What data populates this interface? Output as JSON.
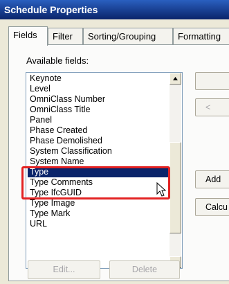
{
  "window": {
    "title": "Schedule Properties"
  },
  "tabs": [
    {
      "label": "Fields",
      "active": true
    },
    {
      "label": "Filter",
      "active": false
    },
    {
      "label": "Sorting/Grouping",
      "active": false
    },
    {
      "label": "Formatting",
      "active": false
    }
  ],
  "fields": {
    "label": "Available fields:",
    "items": [
      {
        "label": "Keynote"
      },
      {
        "label": "Level"
      },
      {
        "label": "OmniClass Number"
      },
      {
        "label": "OmniClass Title"
      },
      {
        "label": "Panel"
      },
      {
        "label": "Phase Created"
      },
      {
        "label": "Phase Demolished"
      },
      {
        "label": "System Classification"
      },
      {
        "label": "System Name"
      },
      {
        "label": "Type",
        "selected": true
      },
      {
        "label": "Type Comments"
      },
      {
        "label": "Type IfcGUID"
      },
      {
        "label": "Type Image"
      },
      {
        "label": "Type Mark"
      },
      {
        "label": "URL"
      }
    ]
  },
  "side_buttons": {
    "remove_label": "<",
    "add_param_label": "Add",
    "calc_label": "Calcu"
  },
  "bottom_buttons": {
    "edit_label": "Edit...",
    "delete_label": "Delete"
  },
  "colors": {
    "highlight_box": "#e32222",
    "selection": "#0a246a"
  },
  "icons": {
    "scroll_up": "scroll-up-arrow-icon",
    "scroll_down": "scroll-down-arrow-icon",
    "cursor": "mouse-pointer-icon"
  }
}
